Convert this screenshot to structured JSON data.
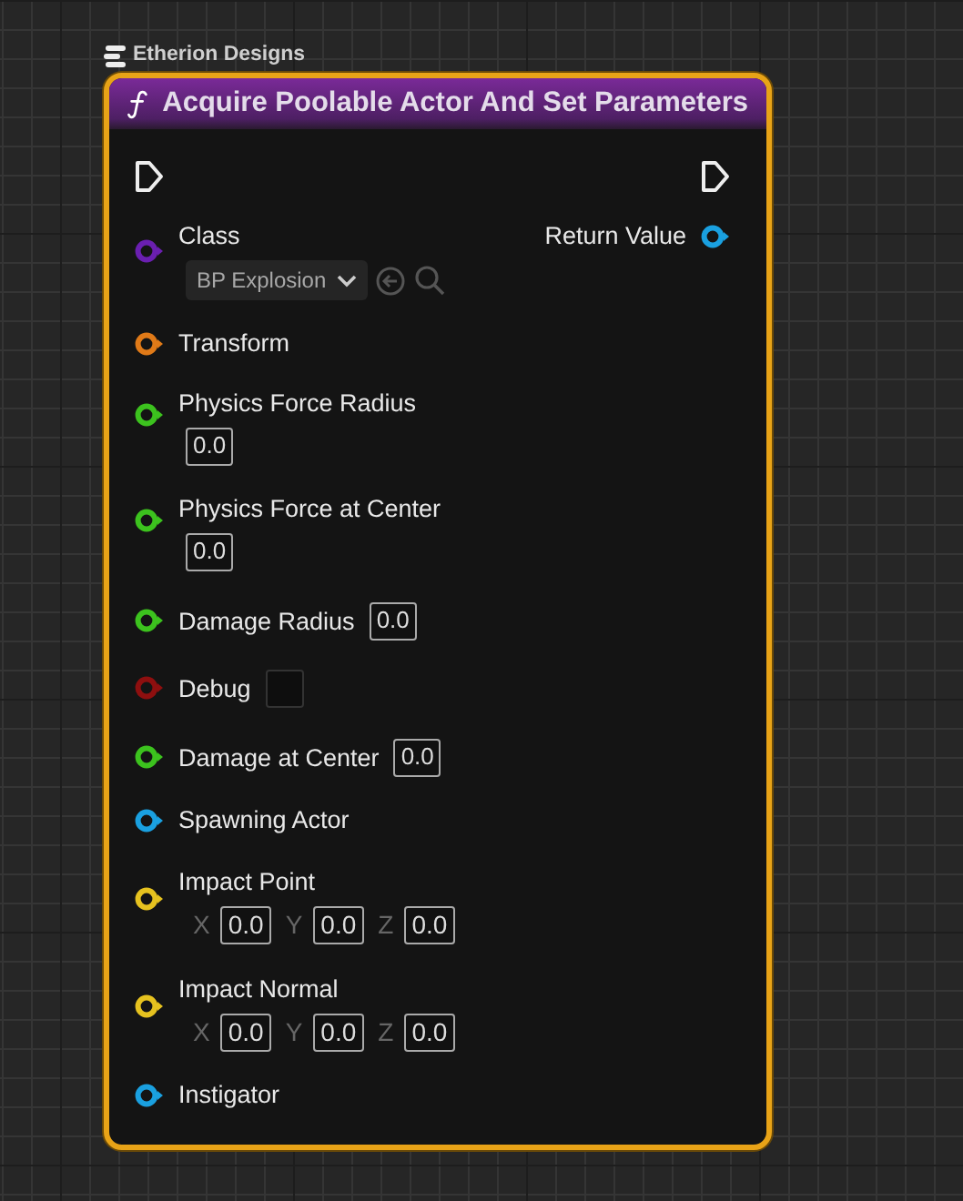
{
  "comment": {
    "title": "Etherion Designs"
  },
  "node": {
    "title": "Acquire Poolable Actor And Set Parameters",
    "output": {
      "label": "Return Value",
      "color": "#1aa0e0"
    },
    "pins": [
      {
        "kind": "class",
        "label": "Class",
        "color": "#6a1fb0",
        "value": "BP Explosion"
      },
      {
        "kind": "plain",
        "label": "Transform",
        "color": "#e07a18"
      },
      {
        "kind": "float_below",
        "label": "Physics Force Radius",
        "color": "#3cc21e",
        "value": "0.0"
      },
      {
        "kind": "float_below",
        "label": "Physics Force at Center",
        "color": "#3cc21e",
        "value": "0.0"
      },
      {
        "kind": "float_inline",
        "label": "Damage Radius",
        "color": "#3cc21e",
        "value": "0.0"
      },
      {
        "kind": "bool",
        "label": "Debug",
        "color": "#8e0f0f",
        "checked": false
      },
      {
        "kind": "float_inline",
        "label": "Damage at Center",
        "color": "#3cc21e",
        "value": "0.0"
      },
      {
        "kind": "plain",
        "label": "Spawning Actor",
        "color": "#1aa0e0"
      },
      {
        "kind": "vector",
        "label": "Impact Point",
        "color": "#e6c21f",
        "axes": [
          {
            "axis": "X",
            "value": "0.0"
          },
          {
            "axis": "Y",
            "value": "0.0"
          },
          {
            "axis": "Z",
            "value": "0.0"
          }
        ]
      },
      {
        "kind": "vector",
        "label": "Impact Normal",
        "color": "#e6c21f",
        "axes": [
          {
            "axis": "X",
            "value": "0.0"
          },
          {
            "axis": "Y",
            "value": "0.0"
          },
          {
            "axis": "Z",
            "value": "0.0"
          }
        ]
      },
      {
        "kind": "plain",
        "label": "Instigator",
        "color": "#1aa0e0"
      }
    ]
  }
}
